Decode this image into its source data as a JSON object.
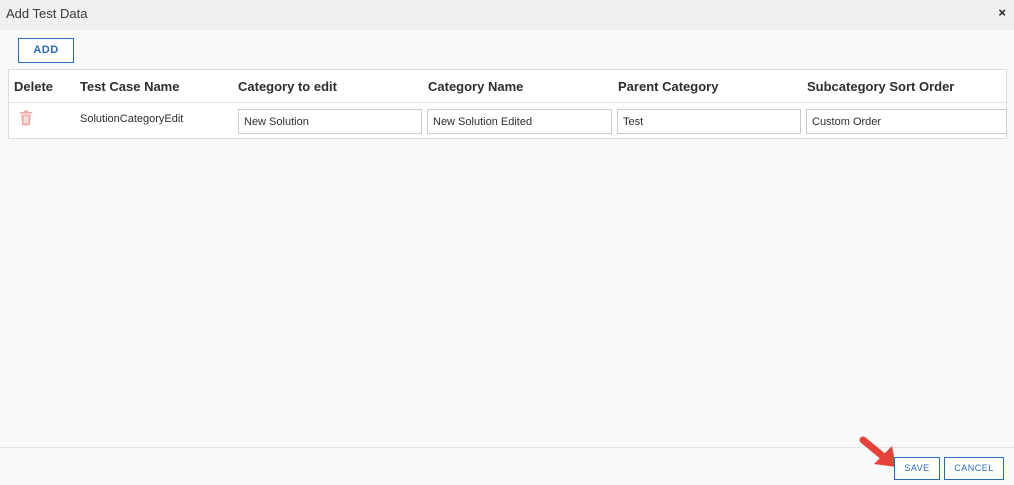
{
  "dialog": {
    "title": "Add Test Data",
    "close_symbol": "×"
  },
  "toolbar": {
    "add_label": "ADD"
  },
  "table": {
    "columns": [
      "Delete",
      "Test Case Name",
      "Category to edit",
      "Category Name",
      "Parent Category",
      "Subcategory Sort Order"
    ],
    "rows": [
      {
        "delete_icon": "trash-icon",
        "test_case_name": "SolutionCategoryEdit",
        "category_to_edit": "New Solution",
        "category_name": "New Solution Edited",
        "parent_category": "Test",
        "subcategory_sort_order": "Custom Order"
      }
    ]
  },
  "footer": {
    "save_label": "SAVE",
    "cancel_label": "CANCEL"
  },
  "annotation": {
    "icon": "red-arrow-icon",
    "color": "#e8413a"
  },
  "colors": {
    "accent": "#2a6bb8",
    "trash": "#f2a7a3",
    "background": "#f9fbfa",
    "titlebar": "#eef1f0"
  }
}
